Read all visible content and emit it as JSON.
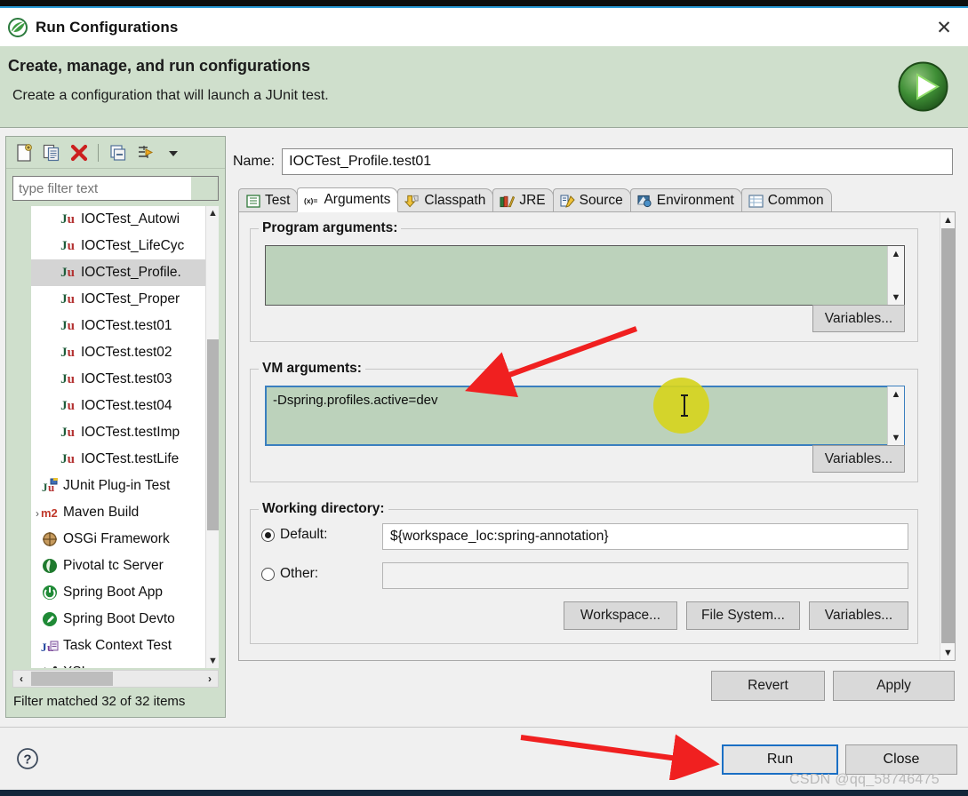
{
  "window": {
    "title": "Run Configurations",
    "logo_icon": "spring-leaf-icon",
    "close_icon": "✕"
  },
  "header": {
    "title": "Create, manage, and run configurations",
    "subtitle": "Create a configuration that will launch a JUnit test.",
    "run_icon": "run-play-icon",
    "accent_green": "#cfdfcc"
  },
  "toolbar": {
    "buttons": [
      {
        "name": "new-launch-configuration",
        "icon": "new-file-icon"
      },
      {
        "name": "duplicate-configuration",
        "icon": "duplicate-icon"
      },
      {
        "name": "delete-configuration",
        "icon": "delete-x-icon"
      },
      {
        "name": "collapse-all",
        "icon": "collapse-all-icon"
      },
      {
        "name": "filter-configurations",
        "icon": "filter-icon"
      },
      {
        "name": "view-menu",
        "icon": "chevron-down-icon"
      }
    ]
  },
  "filter": {
    "placeholder": "type filter text",
    "value": "",
    "status": "Filter matched 32 of 32 items"
  },
  "tree": {
    "items": [
      {
        "label": "IOCTest_Autowi",
        "icon": "junit-icon",
        "indent": 1,
        "selected": false,
        "expander": ""
      },
      {
        "label": "IOCTest_LifeCyc",
        "icon": "junit-icon",
        "indent": 1,
        "selected": false,
        "expander": ""
      },
      {
        "label": "IOCTest_Profile.",
        "icon": "junit-icon",
        "indent": 1,
        "selected": true,
        "expander": ""
      },
      {
        "label": "IOCTest_Proper",
        "icon": "junit-icon",
        "indent": 1,
        "selected": false,
        "expander": ""
      },
      {
        "label": "IOCTest.test01",
        "icon": "junit-icon",
        "indent": 1,
        "selected": false,
        "expander": ""
      },
      {
        "label": "IOCTest.test02",
        "icon": "junit-icon",
        "indent": 1,
        "selected": false,
        "expander": ""
      },
      {
        "label": "IOCTest.test03",
        "icon": "junit-icon",
        "indent": 1,
        "selected": false,
        "expander": ""
      },
      {
        "label": "IOCTest.test04",
        "icon": "junit-icon",
        "indent": 1,
        "selected": false,
        "expander": ""
      },
      {
        "label": "IOCTest.testImp",
        "icon": "junit-icon",
        "indent": 1,
        "selected": false,
        "expander": ""
      },
      {
        "label": "IOCTest.testLife",
        "icon": "junit-icon",
        "indent": 1,
        "selected": false,
        "expander": ""
      },
      {
        "label": "JUnit Plug-in Test",
        "icon": "junit-plugin-icon",
        "indent": 0,
        "selected": false,
        "expander": ""
      },
      {
        "label": "Maven Build",
        "icon": "maven-m2-icon",
        "indent": 0,
        "selected": false,
        "expander": "›"
      },
      {
        "label": "OSGi Framework",
        "icon": "osgi-icon",
        "indent": 0,
        "selected": false,
        "expander": ""
      },
      {
        "label": "Pivotal tc Server",
        "icon": "pivotal-icon",
        "indent": 0,
        "selected": false,
        "expander": ""
      },
      {
        "label": "Spring Boot App",
        "icon": "spring-boot-icon",
        "indent": 0,
        "selected": false,
        "expander": ""
      },
      {
        "label": "Spring Boot Devto",
        "icon": "spring-devtools-icon",
        "indent": 0,
        "selected": false,
        "expander": ""
      },
      {
        "label": "Task Context Test",
        "icon": "task-context-icon",
        "indent": 0,
        "selected": false,
        "expander": ""
      },
      {
        "label": "XSL",
        "icon": "xsl-icon",
        "indent": 0,
        "selected": false,
        "expander": ""
      }
    ]
  },
  "config": {
    "name_label": "Name:",
    "name_value": "IOCTest_Profile.test01",
    "tabs": [
      {
        "label": "Test",
        "icon": "test-list-icon",
        "active": false
      },
      {
        "label": "Arguments",
        "icon": "arguments-xy-icon",
        "active": true
      },
      {
        "label": "Classpath",
        "icon": "classpath-icon",
        "active": false
      },
      {
        "label": "JRE",
        "icon": "jre-books-icon",
        "active": false
      },
      {
        "label": "Source",
        "icon": "source-pencil-icon",
        "active": false
      },
      {
        "label": "Environment",
        "icon": "environment-icon",
        "active": false
      },
      {
        "label": "Common",
        "icon": "common-grid-icon",
        "active": false
      }
    ]
  },
  "arguments_tab": {
    "program_arguments": {
      "legend": "Program arguments:",
      "value": "",
      "variables_button": "Variables..."
    },
    "vm_arguments": {
      "legend": "VM arguments:",
      "value": "-Dspring.profiles.active=dev",
      "variables_button": "Variables...",
      "focused": true
    },
    "working_directory": {
      "legend": "Working directory:",
      "default_label": "Default:",
      "default_selected": true,
      "default_value": "${workspace_loc:spring-annotation}",
      "other_label": "Other:",
      "other_selected": false,
      "other_value": "",
      "buttons": [
        {
          "label": "Workspace...",
          "name": "workspace-button"
        },
        {
          "label": "File System...",
          "name": "file-system-button"
        },
        {
          "label": "Variables...",
          "name": "variables-button"
        }
      ]
    }
  },
  "actions": {
    "revert": "Revert",
    "apply": "Apply",
    "run": "Run",
    "close": "Close",
    "help_icon": "help-question-icon"
  },
  "watermark": "CSDN @qq_58746475",
  "annotations": {
    "arrow_color": "#f02020",
    "cursor_highlight_color": "#d6d41e"
  }
}
